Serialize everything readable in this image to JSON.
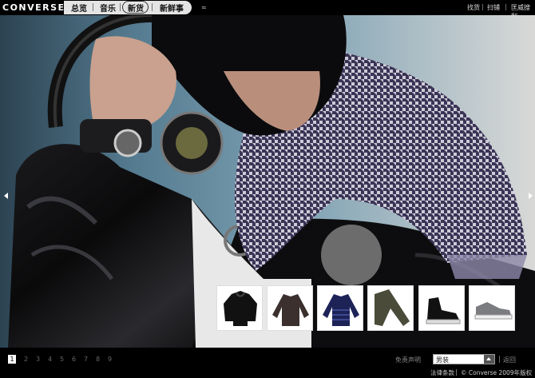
{
  "brand": {
    "logo_text": "CONVERSE"
  },
  "nav": {
    "items": [
      {
        "label": "总览"
      },
      {
        "label": "音乐"
      },
      {
        "label": "新货"
      },
      {
        "label": "新鲜事"
      }
    ],
    "active_index": 2
  },
  "icons": {
    "rss": "rss-icon",
    "prev": "arrow-left-icon",
    "next": "arrow-right-icon",
    "select_toggle": "triangle-up-icon"
  },
  "top_links": [
    {
      "label": "找货"
    },
    {
      "label": "扫铺"
    },
    {
      "label": "匡威搜刮"
    }
  ],
  "thumbnails": [
    {
      "name": "black-hooded-jacket"
    },
    {
      "name": "brown-long-sleeve-top"
    },
    {
      "name": "navy-striped-sweater"
    },
    {
      "name": "olive-pants"
    },
    {
      "name": "black-high-top-sneaker"
    },
    {
      "name": "grey-low-top-sneaker"
    }
  ],
  "pager": {
    "pages": [
      "1",
      "2",
      "3",
      "4",
      "5",
      "6",
      "7",
      "8",
      "9"
    ],
    "active": "1"
  },
  "footer": {
    "disclaimer": "免责声明",
    "category_select": {
      "value": "男装"
    },
    "back": "返回",
    "legal": "法律条款",
    "copyright": "© Converse 2009年版权所有"
  },
  "colors": {
    "topbar": "#000000",
    "nav_pill": "#e4e4e4",
    "page_active": "#ffffff"
  }
}
